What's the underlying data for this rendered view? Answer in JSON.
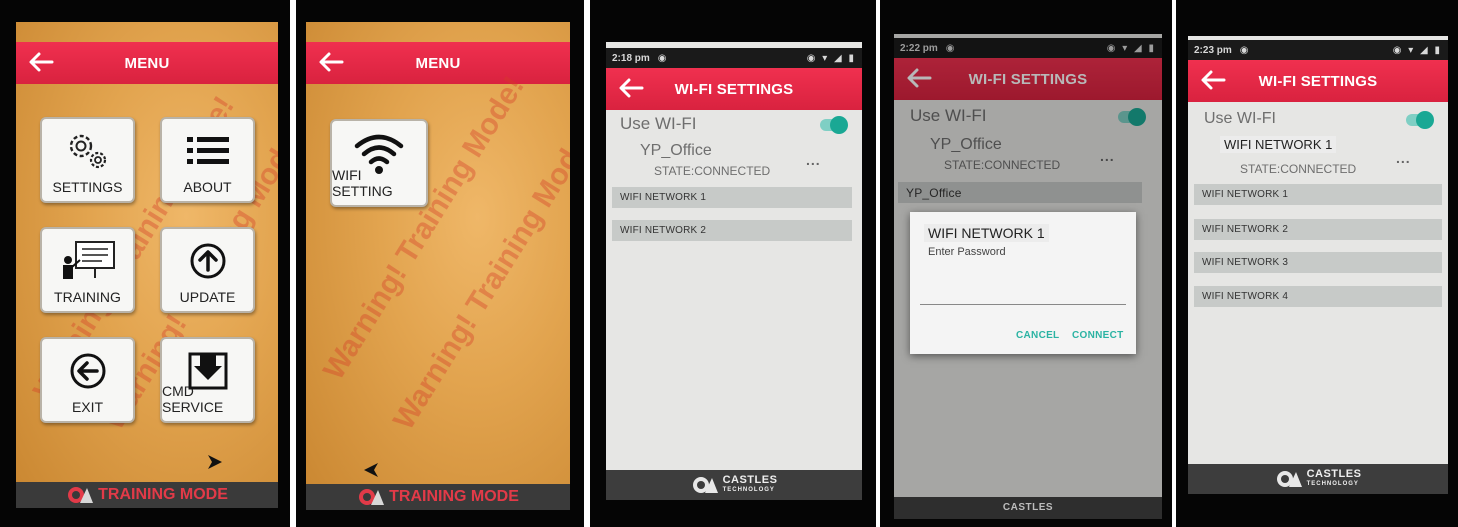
{
  "panel1": {
    "title": "MENU",
    "tiles": [
      {
        "label": "SETTINGS",
        "icon": "gears-icon"
      },
      {
        "label": "ABOUT",
        "icon": "list-icon"
      },
      {
        "label": "TRAINING",
        "icon": "presentation-icon"
      },
      {
        "label": "UPDATE",
        "icon": "upload-arrow-icon"
      },
      {
        "label": "EXIT",
        "icon": "exit-arrow-icon"
      },
      {
        "label": "CMD SERVICE",
        "icon": "download-box-icon"
      }
    ],
    "watermark": "Warning! Training Mode!",
    "footer": "TRAINING MODE"
  },
  "panel2": {
    "title": "MENU",
    "tiles": [
      {
        "label": "WIFI SETTING",
        "icon": "wifi-icon"
      }
    ],
    "watermark": "Warning! Training Mode!",
    "footer": "TRAINING MODE"
  },
  "panel3": {
    "time": "2:18 pm",
    "title": "WI-FI SETTINGS",
    "use_wifi": "Use WI-FI",
    "current_network": "YP_Office",
    "state": "STATE:CONNECTED",
    "more": "...",
    "networks": [
      "WIFI NETWORK 1",
      "WIFI NETWORK 2"
    ],
    "footer": {
      "brand": "CASTLES",
      "sub": "TECHNOLOGY"
    }
  },
  "panel4": {
    "time": "2:22 pm",
    "title": "WI-FI SETTINGS",
    "use_wifi": "Use WI-FI",
    "current_network": "YP_Office",
    "state": "STATE:CONNECTED",
    "more": "...",
    "networks": [
      "YP_Office"
    ],
    "dialog": {
      "title": "WIFI NETWORK 1",
      "hint": "Enter Password",
      "cancel": "CANCEL",
      "connect": "CONNECT"
    },
    "footer": {
      "brand": "CASTLES"
    }
  },
  "panel5": {
    "time": "2:23 pm",
    "title": "WI-FI SETTINGS",
    "use_wifi": "Use WI-FI",
    "current_network": "WIFI NETWORK 1",
    "state": "STATE:CONNECTED",
    "more": "...",
    "networks": [
      "WIFI NETWORK 1",
      "WIFI NETWORK 2",
      "WIFI NETWORK 3",
      "WIFI NETWORK 4"
    ],
    "footer": {
      "brand": "CASTLES",
      "sub": "TECHNOLOGY"
    }
  },
  "colors": {
    "header_red": "#e52a46",
    "teal": "#1aa894",
    "training_red": "#e23a48"
  }
}
